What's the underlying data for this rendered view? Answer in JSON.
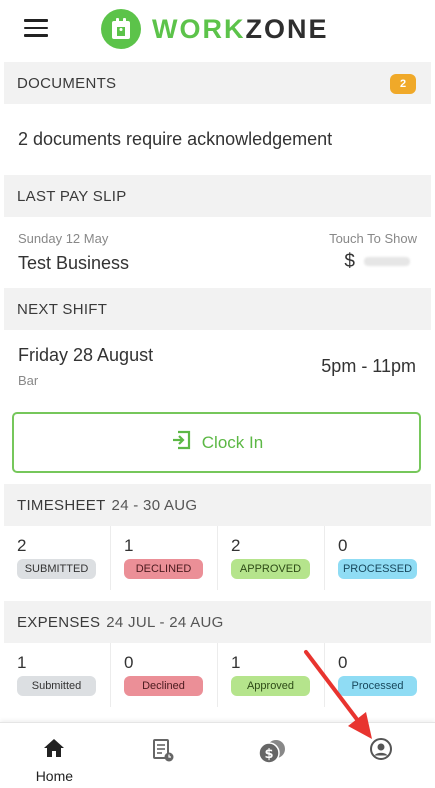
{
  "header": {
    "brand_part1": "WORK",
    "brand_part2": "ZONE"
  },
  "documents": {
    "title": "DOCUMENTS",
    "badge": "2",
    "message": "2 documents require acknowledgement"
  },
  "payslip": {
    "title": "LAST PAY SLIP",
    "date": "Sunday 12 May",
    "business": "Test Business",
    "touch_label": "Touch To Show",
    "currency": "$"
  },
  "shift": {
    "title": "NEXT SHIFT",
    "day": "Friday 28 August",
    "location": "Bar",
    "time": "5pm - 11pm"
  },
  "clock": {
    "label": "Clock In"
  },
  "timesheet": {
    "title": "TIMESHEET",
    "range": "24 - 30 AUG",
    "stats": [
      {
        "count": "2",
        "label": "SUBMITTED"
      },
      {
        "count": "1",
        "label": "DECLINED"
      },
      {
        "count": "2",
        "label": "APPROVED"
      },
      {
        "count": "0",
        "label": "PROCESSED"
      }
    ]
  },
  "expenses": {
    "title": "EXPENSES",
    "range": "24 JUL - 24 AUG",
    "stats": [
      {
        "count": "1",
        "label": "Submitted"
      },
      {
        "count": "0",
        "label": "Declined"
      },
      {
        "count": "1",
        "label": "Approved"
      },
      {
        "count": "0",
        "label": "Processed"
      }
    ]
  },
  "nav": {
    "home_label": "Home"
  },
  "colors": {
    "brand_green": "#5cc34a",
    "badge_orange": "#f0a929",
    "submitted": "#dcdfe2",
    "declined": "#eb8f97",
    "approved": "#b5e48c",
    "processed": "#8fdcf4",
    "annotation_arrow": "#e8342f"
  }
}
